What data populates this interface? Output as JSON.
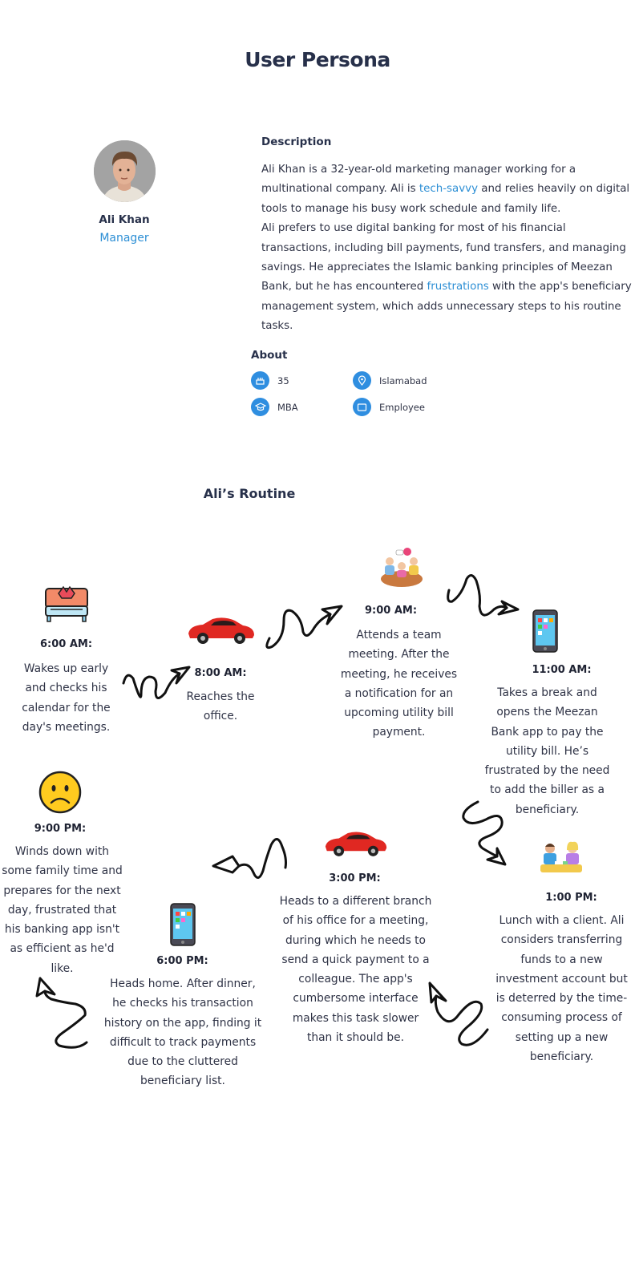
{
  "page_title": "User Persona",
  "persona": {
    "name": "Ali Khan",
    "role": "Manager",
    "description_heading": "Description",
    "description": {
      "p1_a": "Ali Khan is a 32-year-old marketing manager working for a multinational company. Ali is ",
      "p1_hl": "tech-savvy",
      "p1_b": " and relies heavily on digital tools to manage his busy work schedule and family life.",
      "p2_a": "Ali prefers to use digital banking for most of his financial transactions, including bill payments, fund transfers, and managing savings. He appreciates the Islamic banking principles of Meezan Bank, but he has encountered",
      "p2_hl": " frustrations ",
      "p2_b": "with the app's beneficiary management system, which adds unnecessary steps to his routine tasks."
    },
    "about_heading": "About",
    "about": {
      "age": "35",
      "city": "Islamabad",
      "education": "MBA",
      "occupation": "Employee"
    }
  },
  "routine_heading": "Ali’s Routine",
  "routine": [
    {
      "time": "6:00 AM:",
      "text": "Wakes up early and checks his calendar for the day's meetings.",
      "icon": "bed-icon"
    },
    {
      "time": "8:00 AM:",
      "text": "Reaches the office.",
      "icon": "car-icon"
    },
    {
      "time": "9:00 AM:",
      "text": "Attends a team meeting. After the meeting, he receives a notification for an upcoming utility bill payment.",
      "icon": "meeting-icon"
    },
    {
      "time": "11:00 AM:",
      "text": "Takes a break and opens the Meezan Bank app to pay the utility bill. He’s frustrated by the need to add the biller as a beneficiary.",
      "icon": "phone-icon"
    },
    {
      "time": "1:00 PM:",
      "text": "Lunch with a client. Ali considers transferring funds to a new investment account but is deterred by the time-consuming process of setting up a new beneficiary.",
      "icon": "lunch-icon"
    },
    {
      "time": "3:00 PM:",
      "text": "Heads to a different branch of his office for a meeting, during which he needs to send a quick payment to a colleague. The app's cumbersome interface makes this task slower than it should be.",
      "icon": "car-icon"
    },
    {
      "time": "6:00 PM:",
      "text": "Heads home. After dinner, he checks his transaction history on the app, finding it difficult to track payments due to the cluttered beneficiary list.",
      "icon": "phone-icon"
    },
    {
      "time": "9:00 PM:",
      "text": "Winds down with some family time and prepares for the next day, frustrated that his banking app isn't as efficient as he'd like.",
      "icon": "sad-face-icon"
    }
  ]
}
